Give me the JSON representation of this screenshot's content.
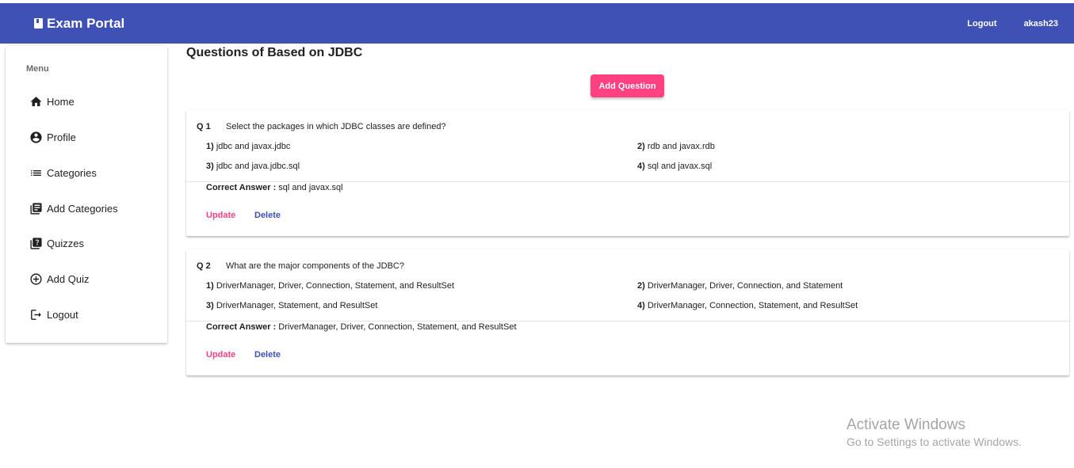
{
  "header": {
    "brand": "Exam Portal",
    "logout_label": "Logout",
    "username": "akash23",
    "bar_color": "#3f51b5"
  },
  "sidebar": {
    "title": "Menu",
    "items": [
      {
        "label": "Home",
        "icon": "home-icon"
      },
      {
        "label": "Profile",
        "icon": "account-circle-icon"
      },
      {
        "label": "Categories",
        "icon": "list-icon"
      },
      {
        "label": "Add Categories",
        "icon": "library-books-icon"
      },
      {
        "label": "Quizzes",
        "icon": "live-help-icon"
      },
      {
        "label": "Add Quiz",
        "icon": "add-circle-outline-icon"
      },
      {
        "label": "Logout",
        "icon": "logout-icon"
      }
    ]
  },
  "main": {
    "title": "Questions of Based on JDBC",
    "add_button": "Add Question",
    "accent_color": "#ff4081"
  },
  "questions": [
    {
      "number": "Q 1",
      "text": "Select the packages in which JDBC classes are defined?",
      "options": [
        {
          "num": "1)",
          "text": "jdbc and javax.jdbc"
        },
        {
          "num": "2)",
          "text": "rdb and javax.rdb"
        },
        {
          "num": "3)",
          "text": "jdbc and java.jdbc.sql"
        },
        {
          "num": "4)",
          "text": "sql and javax.sql"
        }
      ],
      "answer_label": "Correct Answer :",
      "answer": "sql and javax.sql",
      "update_label": "Update",
      "delete_label": "Delete"
    },
    {
      "number": "Q 2",
      "text": "What are the major components of the JDBC?",
      "options": [
        {
          "num": "1)",
          "text": "DriverManager, Driver, Connection, Statement, and ResultSet"
        },
        {
          "num": "2)",
          "text": "DriverManager, Driver, Connection, and Statement"
        },
        {
          "num": "3)",
          "text": "DriverManager, Statement, and ResultSet"
        },
        {
          "num": "4)",
          "text": "DriverManager, Connection, Statement, and ResultSet"
        }
      ],
      "answer_label": "Correct Answer :",
      "answer": "DriverManager, Driver, Connection, Statement, and ResultSet",
      "update_label": "Update",
      "delete_label": "Delete"
    }
  ],
  "watermark": {
    "title": "Activate Windows",
    "subtitle": "Go to Settings to activate Windows."
  }
}
